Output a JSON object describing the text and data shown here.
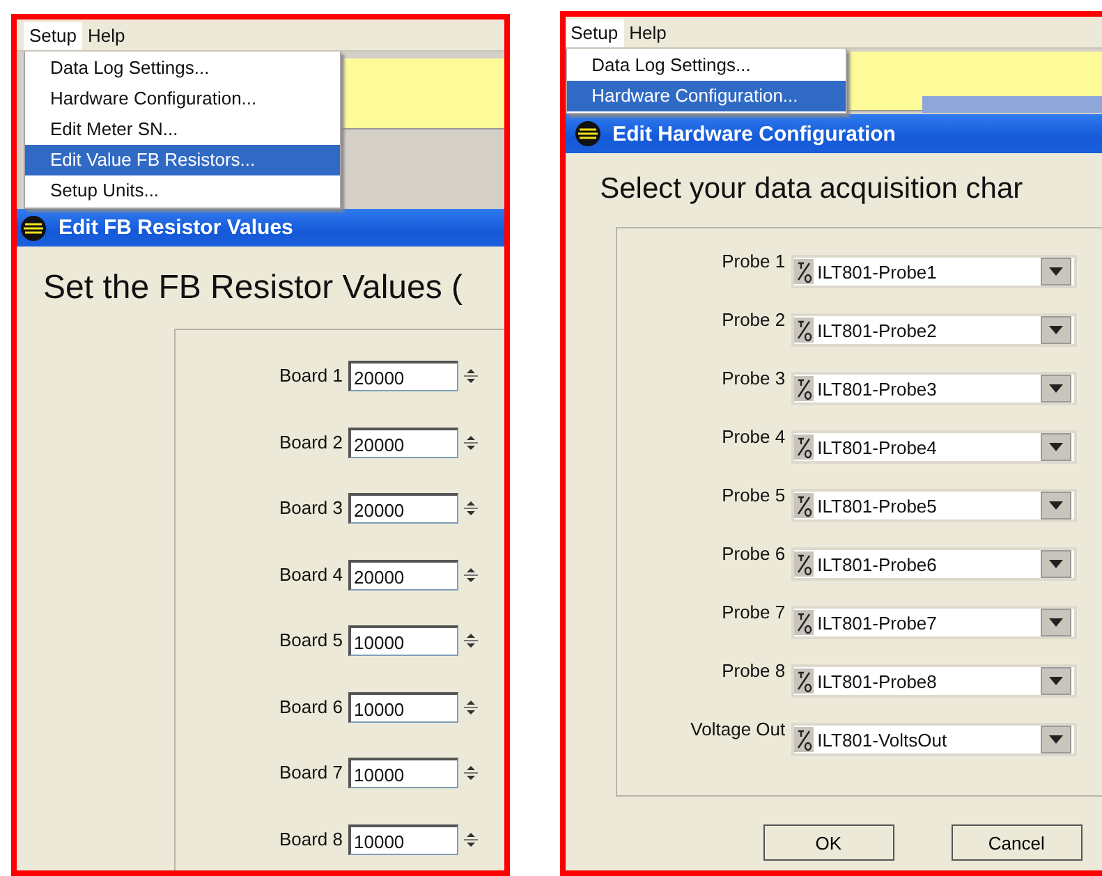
{
  "panels": [
    {
      "menubar": [
        {
          "label": "Setup",
          "selected": true
        },
        {
          "label": "Help",
          "selected": false
        }
      ],
      "menu": [
        {
          "label": "Data Log Settings...",
          "selected": false
        },
        {
          "label": "Hardware Configuration...",
          "selected": false
        },
        {
          "label": "Edit Meter SN...",
          "selected": false
        },
        {
          "label": "Edit Value FB Resistors...",
          "selected": true
        },
        {
          "label": "Setup Units...",
          "selected": false
        }
      ],
      "dialog": {
        "title": "Edit FB Resistor Values",
        "heading": "Set the FB Resistor Values (",
        "rows": [
          {
            "kind": "spinner",
            "label": "Board 1",
            "value": "20000"
          },
          {
            "kind": "spinner",
            "label": "Board 2",
            "value": "20000"
          },
          {
            "kind": "spinner",
            "label": "Board 3",
            "value": "20000"
          },
          {
            "kind": "spinner",
            "label": "Board 4",
            "value": "20000"
          },
          {
            "kind": "spinner",
            "label": "Board 5",
            "value": "10000"
          },
          {
            "kind": "spinner",
            "label": "Board 6",
            "value": "10000"
          },
          {
            "kind": "spinner",
            "label": "Board 7",
            "value": "10000"
          },
          {
            "kind": "spinner",
            "label": "Board 8",
            "value": "10000"
          }
        ]
      }
    },
    {
      "menubar": [
        {
          "label": "Setup",
          "selected": true
        },
        {
          "label": "Help",
          "selected": false
        }
      ],
      "menu": [
        {
          "label": "Data Log Settings...",
          "selected": false
        },
        {
          "label": "Hardware Configuration...",
          "selected": true
        }
      ],
      "dialog": {
        "title": "Edit Hardware Configuration",
        "heading": "Select your data acquisition char",
        "rows": [
          {
            "kind": "dropdown",
            "label": "Probe 1",
            "value": "ILT801-Probe1"
          },
          {
            "kind": "dropdown",
            "label": "Probe 2",
            "value": "ILT801-Probe2"
          },
          {
            "kind": "dropdown",
            "label": "Probe 3",
            "value": "ILT801-Probe3"
          },
          {
            "kind": "dropdown",
            "label": "Probe 4",
            "value": "ILT801-Probe4"
          },
          {
            "kind": "dropdown",
            "label": "Probe 5",
            "value": "ILT801-Probe5"
          },
          {
            "kind": "dropdown",
            "label": "Probe 6",
            "value": "ILT801-Probe6"
          },
          {
            "kind": "dropdown",
            "label": "Probe 7",
            "value": "ILT801-Probe7"
          },
          {
            "kind": "dropdown",
            "label": "Probe 8",
            "value": "ILT801-Probe8"
          },
          {
            "kind": "dropdown",
            "label": "Voltage Out",
            "value": "ILT801-VoltsOut"
          }
        ],
        "buttons": [
          "OK",
          "Cancel"
        ]
      }
    }
  ]
}
